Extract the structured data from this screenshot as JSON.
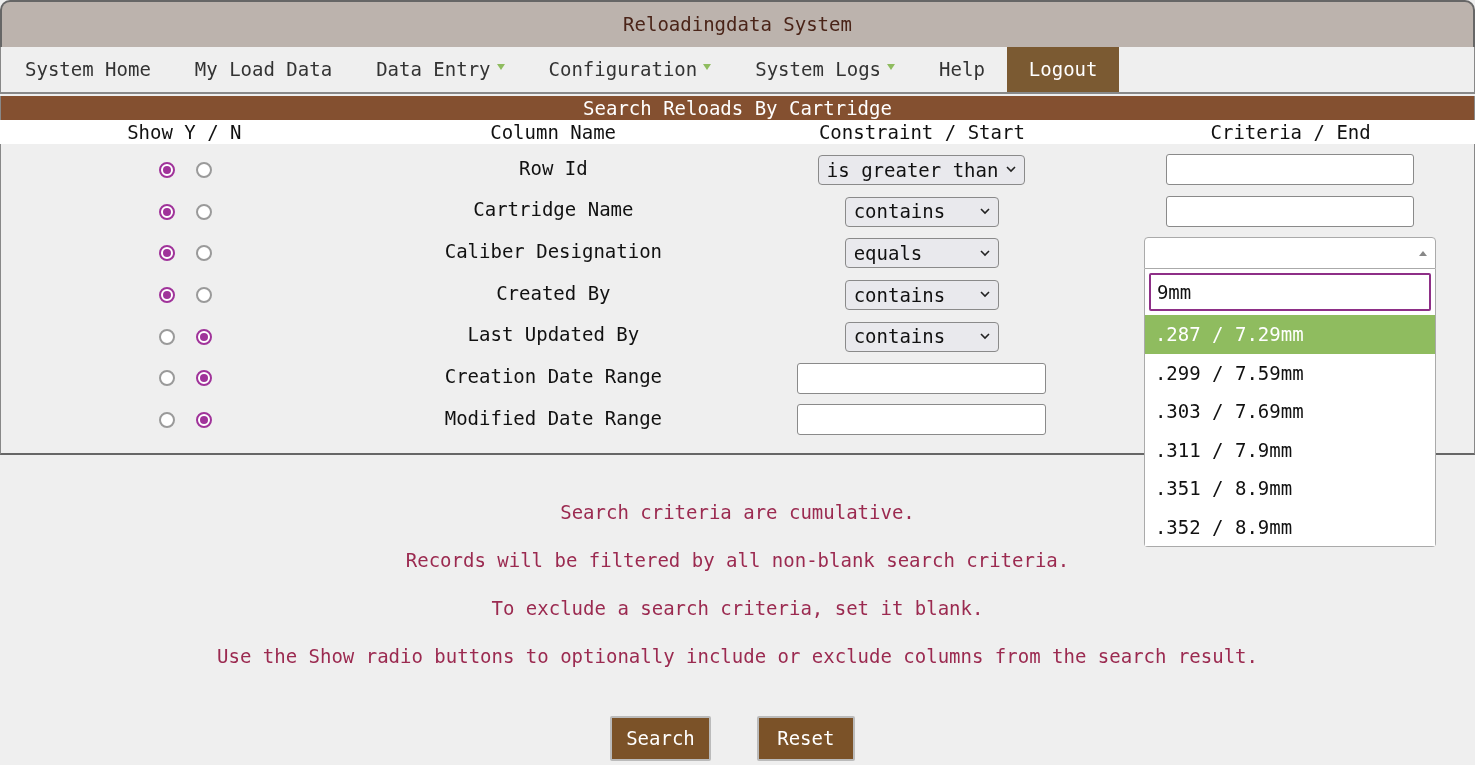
{
  "window": {
    "title": "Reloadingdata System"
  },
  "nav": [
    {
      "label": "System Home",
      "has_menu": false,
      "selected": false
    },
    {
      "label": "My Load Data",
      "has_menu": false,
      "selected": false
    },
    {
      "label": "Data Entry",
      "has_menu": true,
      "selected": false
    },
    {
      "label": "Configuration",
      "has_menu": true,
      "selected": false
    },
    {
      "label": "System Logs",
      "has_menu": true,
      "selected": false
    },
    {
      "label": "Help",
      "has_menu": false,
      "selected": false
    },
    {
      "label": "Logout",
      "has_menu": false,
      "selected": true
    }
  ],
  "section_title": "Search Reloads By Cartridge",
  "columns": [
    "Show Y / N",
    "Column Name",
    "Constraint / Start",
    "Criteria / End"
  ],
  "rows": [
    {
      "name": "Row Id",
      "show": [
        {
          "selected": true
        },
        {
          "selected": false
        }
      ],
      "constraint": {
        "kind": "select",
        "value": "is greater than"
      },
      "criteria": {
        "kind": "input"
      }
    },
    {
      "name": "Cartridge Name",
      "show": [
        {
          "selected": true
        },
        {
          "selected": false
        }
      ],
      "constraint": {
        "kind": "select",
        "value": "contains"
      },
      "criteria": {
        "kind": "input"
      }
    },
    {
      "name": "Caliber Designation",
      "show": [
        {
          "selected": true
        },
        {
          "selected": false
        }
      ],
      "constraint": {
        "kind": "select",
        "value": "equals"
      },
      "criteria": {
        "kind": "combo",
        "search": "9mm",
        "options": [
          {
            "label": ".287 / 7.29mm",
            "selected": true
          },
          {
            "label": ".299 / 7.59mm",
            "selected": false
          },
          {
            "label": ".303 / 7.69mm",
            "selected": false
          },
          {
            "label": ".311 / 7.9mm",
            "selected": false
          },
          {
            "label": ".351 / 8.9mm",
            "selected": false
          },
          {
            "label": ".352 / 8.9mm",
            "selected": false
          }
        ]
      }
    },
    {
      "name": "Created By",
      "show": [
        {
          "selected": true
        },
        {
          "selected": false
        }
      ],
      "constraint": {
        "kind": "select",
        "value": "contains"
      }
    },
    {
      "name": "Last Updated By",
      "show": [
        {
          "selected": false
        },
        {
          "selected": true
        }
      ],
      "constraint": {
        "kind": "select",
        "value": "contains"
      }
    },
    {
      "name": "Creation Date Range",
      "show": [
        {
          "selected": false
        },
        {
          "selected": true
        }
      ],
      "constraint": {
        "kind": "input"
      }
    },
    {
      "name": "Modified Date Range",
      "show": [
        {
          "selected": false
        },
        {
          "selected": true
        }
      ],
      "constraint": {
        "kind": "input"
      }
    }
  ],
  "messages": [
    "Search criteria are cumulative.",
    "Records will be filtered by all non-blank search criteria.",
    "To exclude a search criteria, set it blank.",
    "Use the Show radio buttons to optionally include or exclude columns from the search result."
  ],
  "buttons": [
    "Search",
    "Reset"
  ]
}
